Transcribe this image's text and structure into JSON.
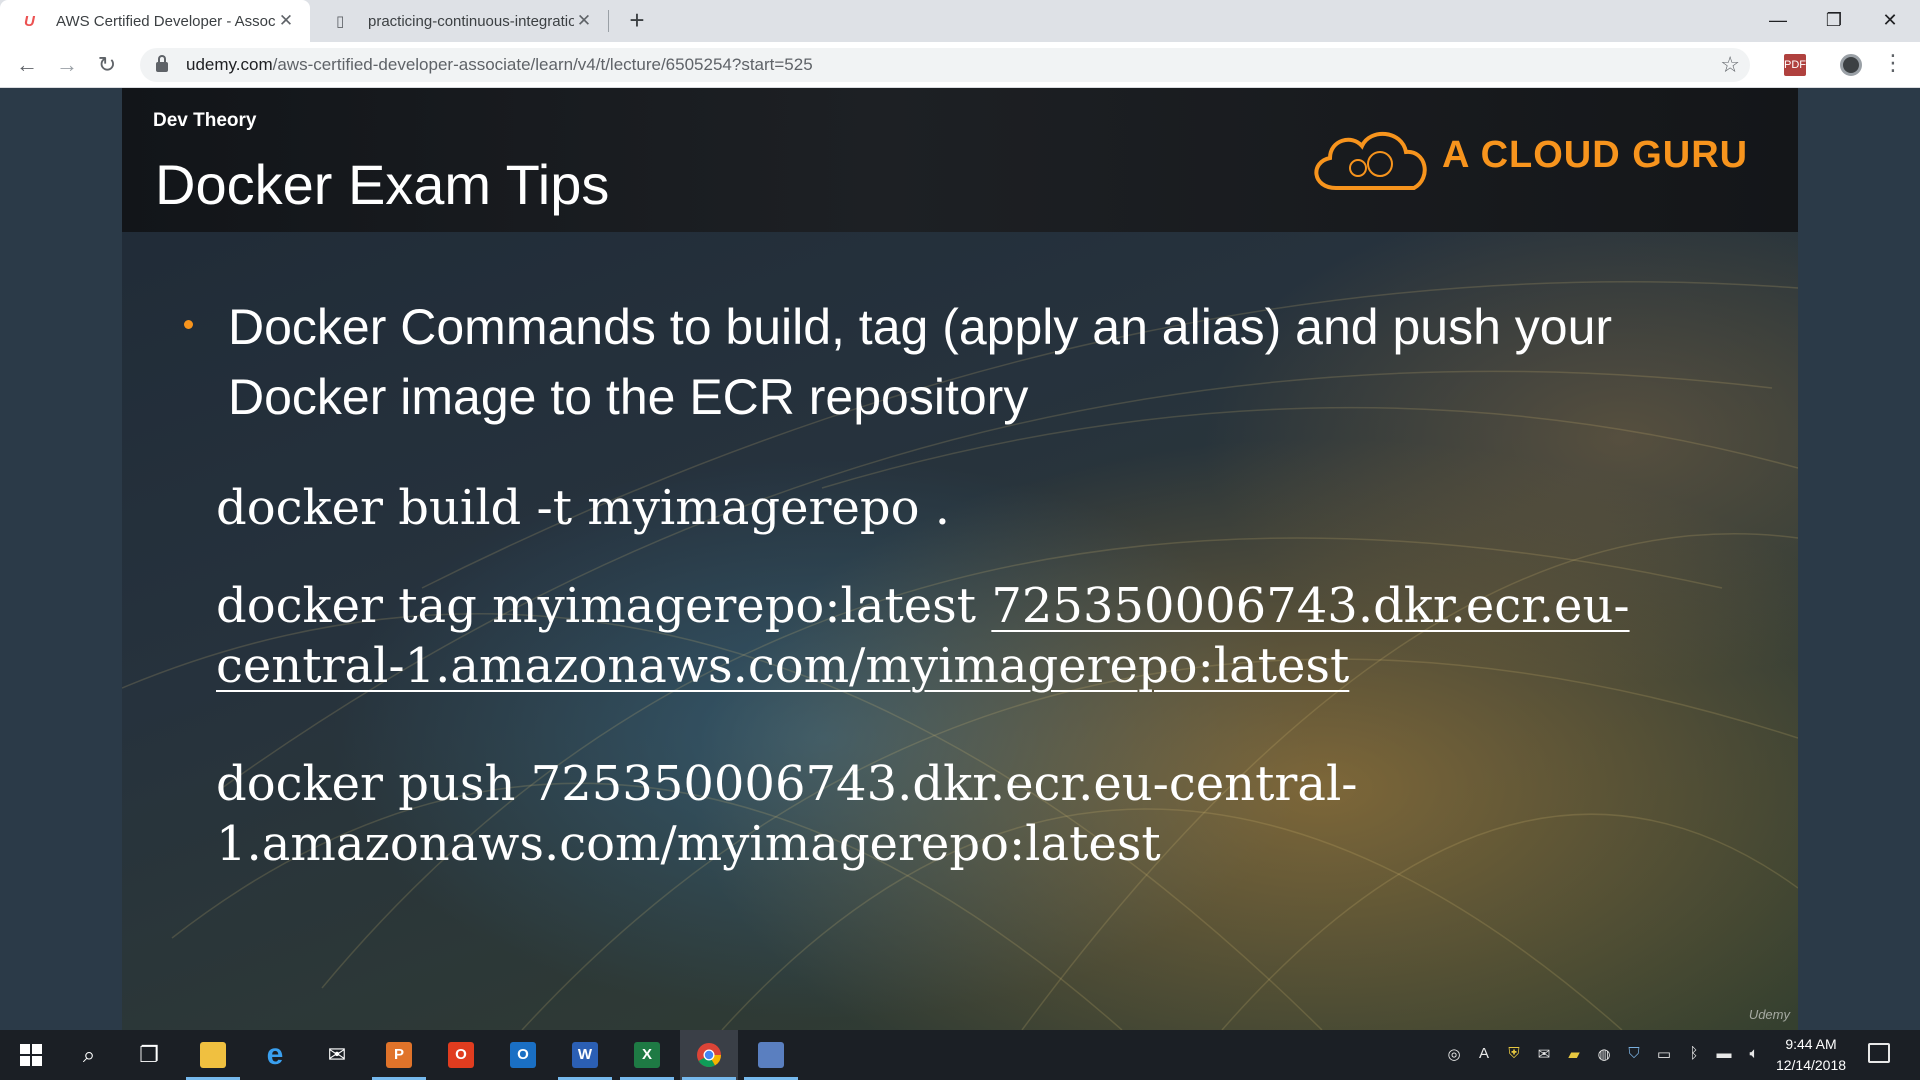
{
  "browser": {
    "tabs": [
      {
        "title": "AWS Certified Developer - Associ",
        "icon": "U",
        "active": true
      },
      {
        "title": "practicing-continuous-integratio",
        "icon": "▯",
        "active": false
      }
    ],
    "new_tab_label": "+",
    "url_host": "udemy.com",
    "url_path": "/aws-certified-developer-associate/learn/v4/t/lecture/6505254?start=525",
    "pdf_ext_label": "PDF"
  },
  "slide": {
    "section": "Dev Theory",
    "title": "Docker Exam Tips",
    "brand": "A CLOUD GURU",
    "bullet": "Docker Commands to build, tag (apply an alias) and push your Docker image to the ECR repository",
    "cmd_build": "docker build -t myimagerepo .",
    "cmd_tag_prefix": "docker tag myimagerepo:latest",
    "cmd_tag_target": "725350006743.dkr.ecr.eu-central-1.amazonaws.com/myimagerepo:latest",
    "cmd_push_prefix": "docker push",
    "cmd_push_target": "725350006743.dkr.ecr.eu-central-1.amazonaws.com/myimagerepo:latest",
    "watermark": "Udemy"
  },
  "taskbar": {
    "time": "9:44 AM",
    "date": "12/14/2018"
  },
  "colors": {
    "brand_orange": "#f7941d",
    "taskbar": "#1b1f25",
    "active_indicator": "#76b9ed"
  }
}
